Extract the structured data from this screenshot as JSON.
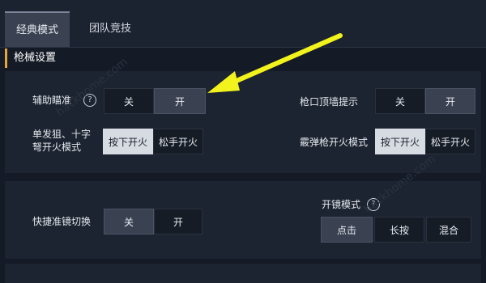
{
  "tabs": [
    {
      "label": "经典模式"
    },
    {
      "label": "团队竞技"
    }
  ],
  "section_title": "枪械设置",
  "settings": {
    "aim_assist": {
      "label": "辅助瞄准",
      "help": "?",
      "options": [
        "关",
        "开"
      ]
    },
    "wall_hint": {
      "label": "枪口顶墙提示",
      "options": [
        "关",
        "开"
      ]
    },
    "sniper_fire_mode": {
      "label_line1": "单发狙、十字",
      "label_line2": "弩开火模式",
      "options": [
        "按下开火",
        "松手开火"
      ]
    },
    "shotgun_fire_mode": {
      "label": "霰弹枪开火模式",
      "options": [
        "按下开火",
        "松手开火"
      ]
    },
    "quick_scope_switch": {
      "label": "快捷准镜切换",
      "options": [
        "关",
        "开"
      ]
    },
    "scope_mode": {
      "label": "开镜模式",
      "help": "?",
      "options": [
        "点击",
        "长按",
        "混合"
      ]
    }
  },
  "watermark": "hackhome.com",
  "colors": {
    "accent": "#e8a33a",
    "arrow": "#f2f21c",
    "selected": "#3a4252"
  }
}
